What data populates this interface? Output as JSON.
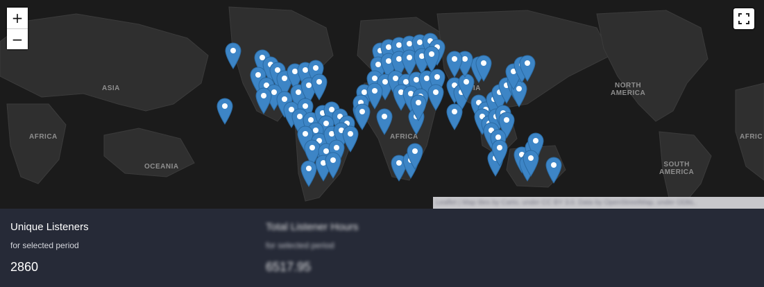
{
  "map": {
    "zoom_in_label": "+",
    "zoom_out_label": "−",
    "region_labels": {
      "asia_left": "ASIA",
      "africa_left": "AFRICA",
      "oceania": "OCEANIA",
      "africa": "AFRICA",
      "asia": "ASIA",
      "north_america": "NORTH\nAMERICA",
      "south_america": "SOUTH\nAMERICA",
      "africa_right": "AFRIC"
    },
    "attribution": "Leaflet | Map tiles by Carto, under CC BY 3.0. Data by OpenStreetMap, under ODbL.",
    "pin_color": "#3d85c6",
    "icons": {
      "zoom_in": "plus-icon",
      "zoom_out": "minus-icon",
      "fullscreen": "fullscreen-icon",
      "marker": "map-pin-icon"
    }
  },
  "stats": {
    "listeners": {
      "title": "Unique Listeners",
      "subtitle": "for selected period",
      "value": "2860"
    },
    "hours": {
      "title": "Total Listener Hours",
      "subtitle": "for selected period",
      "value": "6517.95"
    }
  },
  "colors": {
    "map_background": "#1b1b1b",
    "stats_background": "#262a37"
  }
}
